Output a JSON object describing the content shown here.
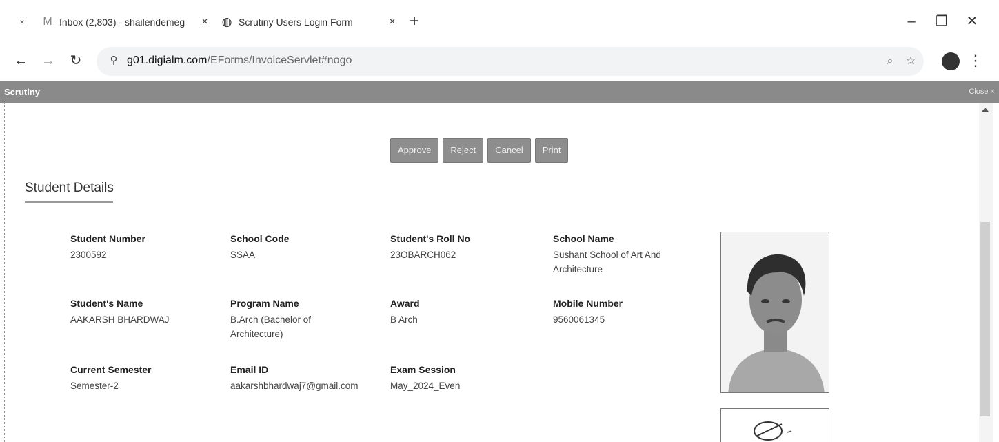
{
  "browser": {
    "tabs": [
      {
        "label": "Inbox (2,803) - shailendemeg",
        "icon": "gmail-icon",
        "active": false
      },
      {
        "label": "Scrutiny Users Login Form",
        "icon": "globe-icon",
        "active": true
      }
    ],
    "new_tab_label": "+",
    "url_host": "g01.digialm.com",
    "url_path": "/EForms/InvoiceServlet#nogo",
    "window_controls": {
      "minimize": "–",
      "restore": "❐",
      "close": "✕"
    }
  },
  "dialog": {
    "title": "Scrutiny",
    "close_label": "Close ×"
  },
  "actions": {
    "approve": "Approve",
    "reject": "Reject",
    "cancel": "Cancel",
    "print": "Print"
  },
  "student_details": {
    "heading": "Student Details",
    "fields": {
      "student_number": {
        "label": "Student Number",
        "value": "2300592"
      },
      "school_code": {
        "label": "School Code",
        "value": "SSAA"
      },
      "roll_no": {
        "label": "Student's Roll No",
        "value": "23OBARCH062"
      },
      "school_name": {
        "label": "School Name",
        "value": "Sushant School of Art And Architecture"
      },
      "student_name": {
        "label": "Student's Name",
        "value": "AAKARSH BHARDWAJ"
      },
      "program_name": {
        "label": "Program Name",
        "value": "B.Arch (Bachelor of Architecture)"
      },
      "award": {
        "label": "Award",
        "value": "B Arch"
      },
      "mobile_number": {
        "label": "Mobile Number",
        "value": "9560061345"
      },
      "current_semester": {
        "label": "Current Semester",
        "value": "Semester-2"
      },
      "email_id": {
        "label": "Email ID",
        "value": "aakarshbhardwaj7@gmail.com"
      },
      "exam_session": {
        "label": "Exam Session",
        "value": "May_2024_Even"
      }
    }
  }
}
